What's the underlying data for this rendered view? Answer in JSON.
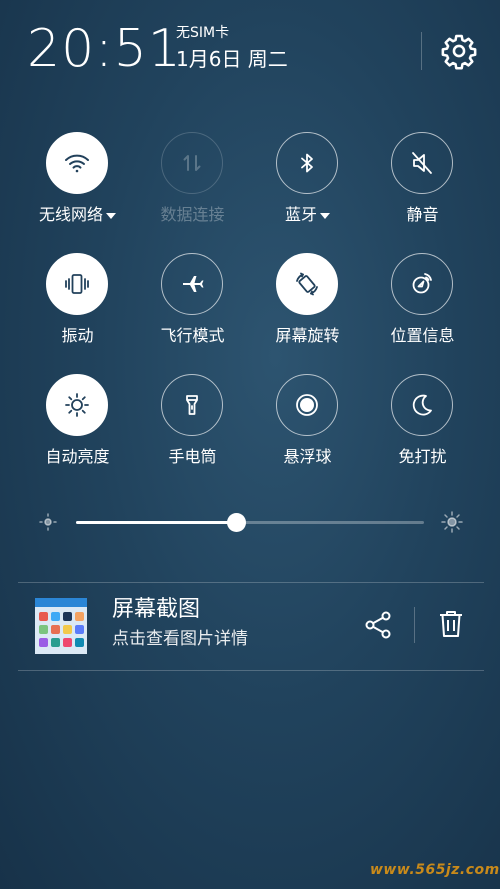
{
  "status": {
    "time": "20:51",
    "sim": "无SIM卡",
    "date": "1月6日 周二"
  },
  "toggles": [
    {
      "label": "无线网络",
      "icon": "wifi-icon",
      "state": "on",
      "dropdown": true
    },
    {
      "label": "数据连接",
      "icon": "data-arrows-icon",
      "state": "disabled",
      "dropdown": false
    },
    {
      "label": "蓝牙",
      "icon": "bluetooth-icon",
      "state": "off",
      "dropdown": true
    },
    {
      "label": "静音",
      "icon": "mute-icon",
      "state": "off",
      "dropdown": false
    },
    {
      "label": "振动",
      "icon": "vibrate-icon",
      "state": "on",
      "dropdown": false
    },
    {
      "label": "飞行模式",
      "icon": "airplane-icon",
      "state": "off",
      "dropdown": false
    },
    {
      "label": "屏幕旋转",
      "icon": "rotate-icon",
      "state": "on",
      "dropdown": false
    },
    {
      "label": "位置信息",
      "icon": "location-icon",
      "state": "off",
      "dropdown": false
    },
    {
      "label": "自动亮度",
      "icon": "auto-brightness-icon",
      "state": "on",
      "dropdown": false
    },
    {
      "label": "手电筒",
      "icon": "flashlight-icon",
      "state": "off",
      "dropdown": false
    },
    {
      "label": "悬浮球",
      "icon": "floating-ball-icon",
      "state": "off",
      "dropdown": false
    },
    {
      "label": "免打扰",
      "icon": "moon-icon",
      "state": "off",
      "dropdown": false
    }
  ],
  "brightness": {
    "level": 0.46
  },
  "notification": {
    "title": "屏幕截图",
    "subtitle": "点击查看图片详情"
  },
  "watermark": "www.565jz.com",
  "colors": {
    "background": "#21435d",
    "tile_on": "#ffffff",
    "icon_on": "#22415b",
    "watermark": "#c98a1a"
  }
}
